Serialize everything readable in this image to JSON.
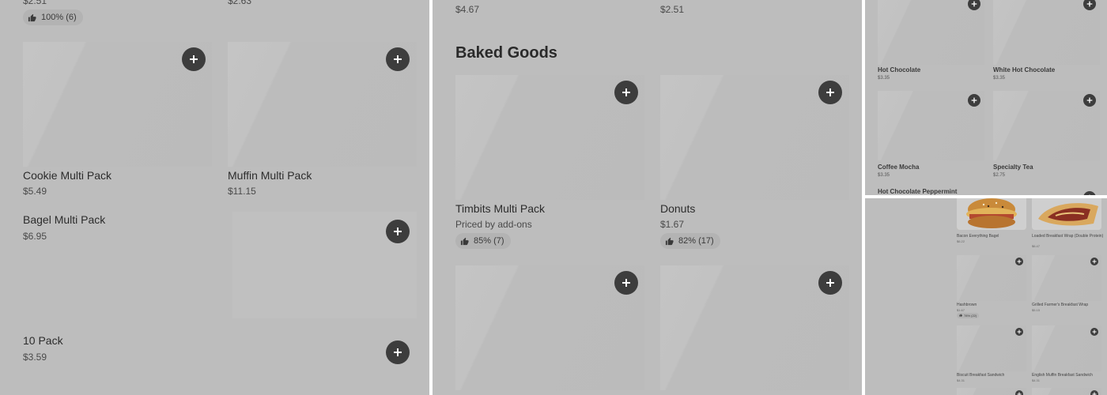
{
  "panel1": {
    "top_price_1": "$2.51",
    "top_price_2": "$2.63",
    "top_rating": "100% (6)",
    "items": [
      {
        "name": "Cookie Multi Pack",
        "price": "$5.49"
      },
      {
        "name": "Muffin Multi Pack",
        "price": "$11.15"
      },
      {
        "name": "Bagel Multi Pack",
        "price": "$6.95"
      },
      {
        "name": "10 Pack",
        "price": "$3.59"
      }
    ]
  },
  "panel2": {
    "top_price_1": "$4.67",
    "top_price_2": "$2.51",
    "section_title": "Baked Goods",
    "items": [
      {
        "name": "Timbits Multi Pack",
        "price": "Priced by add-ons",
        "rating": "85% (7)"
      },
      {
        "name": "Donuts",
        "price": "$1.67",
        "rating": "82% (17)"
      }
    ]
  },
  "panel3": {
    "items": [
      {
        "name": "Hot Chocolate",
        "price": "$3.35"
      },
      {
        "name": "White Hot Chocolate",
        "price": "$3.35"
      },
      {
        "name": "Coffee Mocha",
        "price": "$3.35"
      },
      {
        "name": "Specialty Tea",
        "price": "$2.75"
      },
      {
        "name": "Hot Chocolate Peppermint",
        "price": ""
      }
    ]
  },
  "panel4": {
    "items": [
      {
        "name": "Bacon Everything Bagel",
        "price": "$6.22"
      },
      {
        "name": "Loaded Breakfast Wrap (Double Protein)",
        "price": "$6.47"
      },
      {
        "name": "Hashbrown",
        "price": "$1.67",
        "rating": "78% (22)"
      },
      {
        "name": "Grilled Farmer's Breakfast Wrap",
        "price": "$5.15"
      },
      {
        "name": "Biscuit Breakfast Sandwich",
        "price": "$4.31"
      },
      {
        "name": "English Muffin Breakfast Sandwich",
        "price": "$4.31"
      }
    ]
  },
  "icons": {
    "add": "plus-icon",
    "rating": "thumbs-up-icon"
  }
}
